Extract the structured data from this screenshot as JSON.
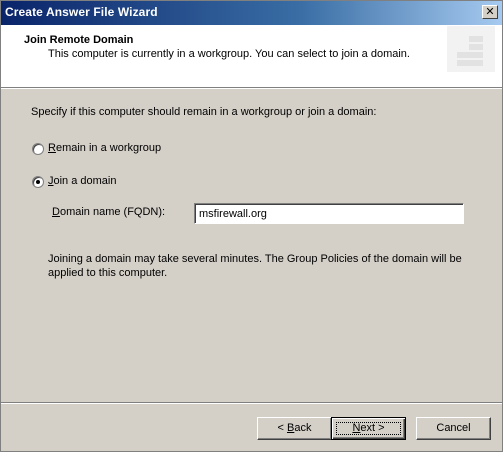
{
  "window": {
    "title": "Create Answer File Wizard",
    "close_symbol": "✕"
  },
  "header": {
    "title": "Join Remote Domain",
    "subtitle": "This computer is currently in a workgroup. You can select to join a domain."
  },
  "body": {
    "prompt": "Specify if this computer should remain in a workgroup or join a domain:",
    "options": [
      {
        "label_key": "R",
        "label_rest": "emain in a workgroup",
        "selected": false
      },
      {
        "label_key": "J",
        "label_rest": "oin a domain",
        "selected": true
      }
    ],
    "domain": {
      "label_key": "D",
      "label_rest": "omain name (FQDN):",
      "value": "msfirewall.org"
    },
    "note": "Joining a domain may take several minutes. The Group Policies of the domain will be applied to this computer."
  },
  "buttons": {
    "back": {
      "prefix": "< ",
      "key": "B",
      "rest": "ack"
    },
    "next": {
      "key": "N",
      "rest": "ext >"
    },
    "cancel": "Cancel"
  }
}
